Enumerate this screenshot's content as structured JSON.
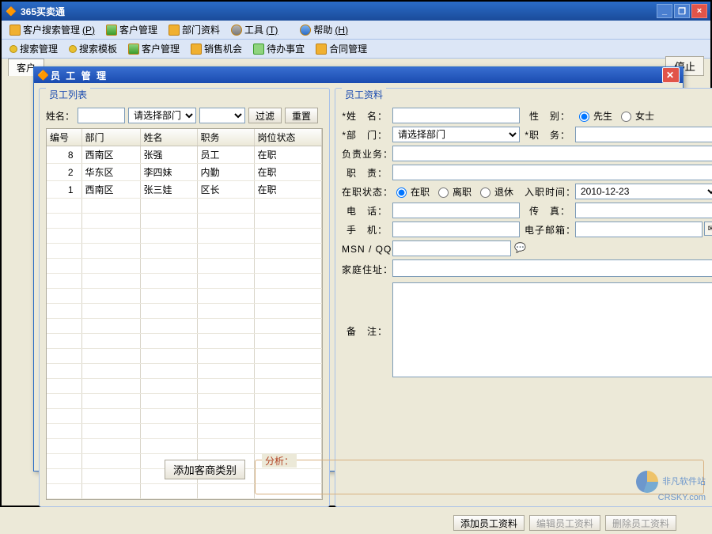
{
  "window": {
    "title": "365买卖通",
    "controls": {
      "minimize": "_",
      "restore": "❐",
      "close": "×"
    }
  },
  "menubar": {
    "items": [
      {
        "label": "客户搜索管理",
        "hotkey": "(P)"
      },
      {
        "label": "客户管理"
      },
      {
        "label": "部门资料"
      },
      {
        "label": "工具",
        "hotkey": "(T)"
      },
      {
        "label": "帮助",
        "hotkey": "(H)"
      }
    ]
  },
  "toolbar": {
    "items": [
      {
        "label": "搜索管理"
      },
      {
        "label": "搜索模板"
      },
      {
        "label": "客户管理"
      },
      {
        "label": "销售机会"
      },
      {
        "label": "待办事宜"
      },
      {
        "label": "合同管理"
      }
    ]
  },
  "tabs": {
    "left": "客户",
    "stop_button": "停止"
  },
  "modal": {
    "title": "员 工 管 理",
    "list_panel": {
      "legend": "员工列表",
      "filter": {
        "name_label": "姓名：",
        "name_value": "",
        "dept_label": "请选择部门",
        "dept_value": "",
        "filter_btn": "过滤",
        "reset_btn": "重置"
      },
      "columns": [
        "编号",
        "部门",
        "姓名",
        "职务",
        "岗位状态"
      ],
      "rows": [
        {
          "id": "8",
          "dept": "西南区",
          "name": "张强",
          "job": "员工",
          "status": "在职"
        },
        {
          "id": "2",
          "dept": "华东区",
          "name": "李四妹",
          "job": "内勤",
          "status": "在职"
        },
        {
          "id": "1",
          "dept": "西南区",
          "name": "张三娃",
          "job": "区长",
          "status": "在职"
        }
      ]
    },
    "detail_panel": {
      "legend": "员工资料",
      "labels": {
        "name": "*姓　名：",
        "gender": "性　别：",
        "gender_male": "先生",
        "gender_female": "女士",
        "dept": "*部　门：",
        "dept_placeholder": "请选择部门",
        "job": "*职　务：",
        "business": "负责业务：",
        "duty": "职　责：",
        "status": "在职状态：",
        "status_on": "在职",
        "status_off": "离职",
        "status_retire": "退休",
        "hire_date": "入职时间：",
        "hire_date_value": "2010-12-23",
        "phone": "电　话：",
        "fax": "传　真：",
        "mobile": "手　机：",
        "email": "电子邮箱：",
        "msn": "MSN / QQ：",
        "address": "家庭住址：",
        "notes": "备　注："
      },
      "values": {
        "name": "",
        "dept": "",
        "job": "",
        "business": "",
        "duty": "",
        "phone": "",
        "fax": "",
        "mobile": "",
        "email": "",
        "msn": "",
        "address": "",
        "notes": ""
      }
    },
    "footer": {
      "add": "添加员工资料",
      "edit": "编辑员工资料",
      "delete": "删除员工资料"
    }
  },
  "main_bottom": {
    "add_category": "添加客商类别",
    "analysis_label": "分析："
  },
  "watermark": {
    "line1": "非凡软件站",
    "line2": "CRSKY.com"
  }
}
